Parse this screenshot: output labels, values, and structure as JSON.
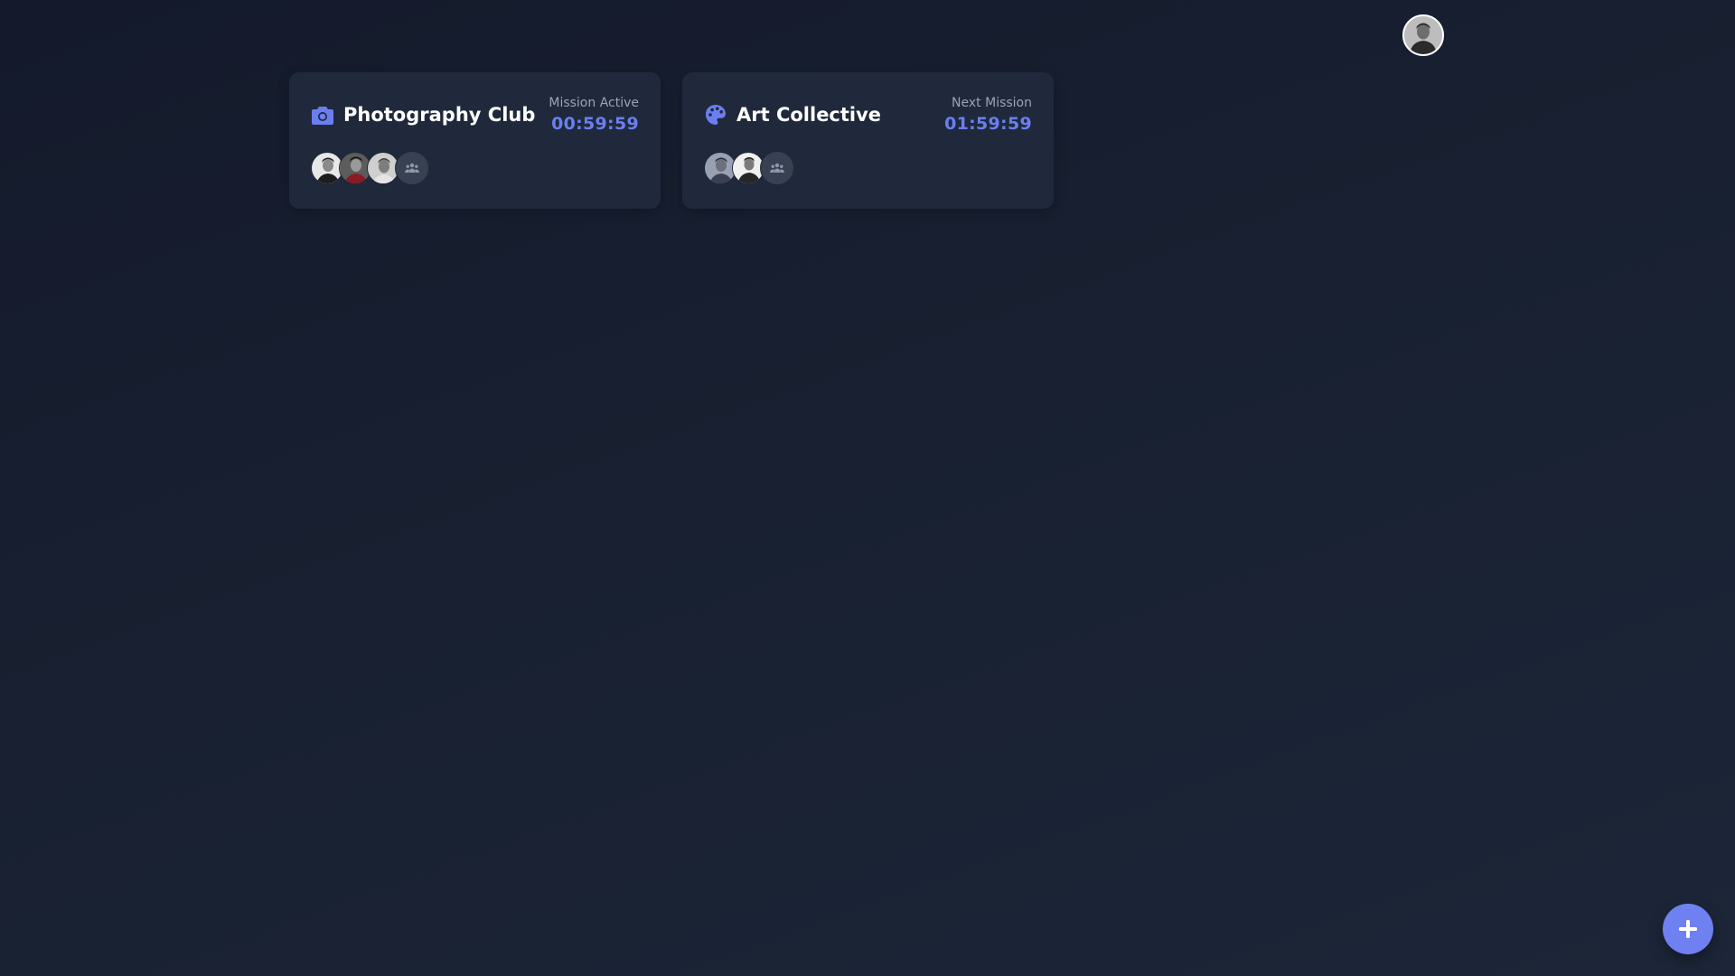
{
  "header": {
    "profile_avatar_icon": "user-portrait-avatar"
  },
  "clubs": [
    {
      "name": "Photography Club",
      "icon": "camera-icon",
      "status_label": "Mission Active",
      "timer": "00:59:59",
      "member_avatars": [
        "member-portrait-1",
        "member-portrait-2",
        "member-portrait-3"
      ],
      "more_icon": "group-icon"
    },
    {
      "name": "Art Collective",
      "icon": "palette-icon",
      "status_label": "Next Mission",
      "timer": "01:59:59",
      "member_avatars": [
        "member-portrait-1",
        "member-portrait-2"
      ],
      "more_icon": "group-icon"
    }
  ],
  "fab": {
    "icon": "plus-icon"
  },
  "colors": {
    "accent": "#6b7ef0",
    "card_background": "#1f293b",
    "page_background": "#182031",
    "muted_text": "#9aa4b8",
    "fab_background": "#6f80f1"
  }
}
